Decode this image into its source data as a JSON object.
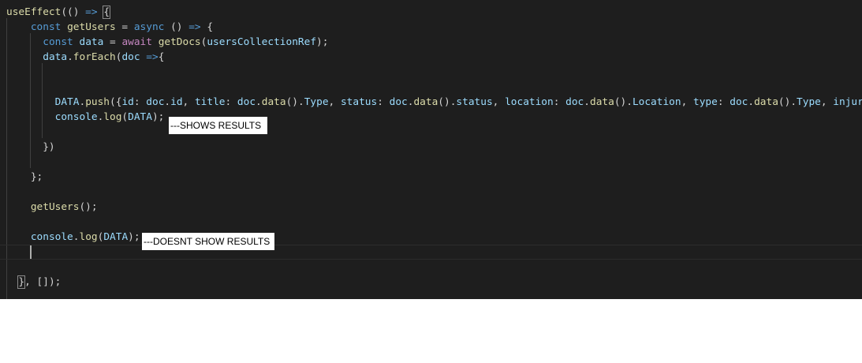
{
  "editor": {
    "background": "#1e1e1e",
    "lines": [
      [
        {
          "t": "useEffect",
          "c": "fn"
        },
        {
          "t": "(() ",
          "c": "pun"
        },
        {
          "t": "=>",
          "c": "kw"
        },
        {
          "t": " ",
          "c": "pun"
        },
        {
          "t": "{",
          "c": "pun",
          "bracket": true
        }
      ],
      [
        {
          "t": "    ",
          "c": "pun"
        },
        {
          "t": "const",
          "c": "kw"
        },
        {
          "t": " ",
          "c": "pun"
        },
        {
          "t": "getUsers",
          "c": "fn"
        },
        {
          "t": " = ",
          "c": "pun"
        },
        {
          "t": "async",
          "c": "kw"
        },
        {
          "t": " () ",
          "c": "pun"
        },
        {
          "t": "=>",
          "c": "kw"
        },
        {
          "t": " {",
          "c": "pun"
        }
      ],
      [
        {
          "t": "      ",
          "c": "pun"
        },
        {
          "t": "const",
          "c": "kw"
        },
        {
          "t": " ",
          "c": "pun"
        },
        {
          "t": "data",
          "c": "var"
        },
        {
          "t": " = ",
          "c": "pun"
        },
        {
          "t": "await",
          "c": "ctl"
        },
        {
          "t": " ",
          "c": "pun"
        },
        {
          "t": "getDocs",
          "c": "fn"
        },
        {
          "t": "(",
          "c": "pun"
        },
        {
          "t": "usersCollectionRef",
          "c": "var"
        },
        {
          "t": ");",
          "c": "pun"
        }
      ],
      [
        {
          "t": "      ",
          "c": "pun"
        },
        {
          "t": "data",
          "c": "var"
        },
        {
          "t": ".",
          "c": "pun"
        },
        {
          "t": "forEach",
          "c": "fn"
        },
        {
          "t": "(",
          "c": "pun"
        },
        {
          "t": "doc",
          "c": "var"
        },
        {
          "t": " ",
          "c": "pun"
        },
        {
          "t": "=>",
          "c": "kw"
        },
        {
          "t": "{",
          "c": "pun"
        }
      ],
      [],
      [],
      [
        {
          "t": "        ",
          "c": "pun"
        },
        {
          "t": "DATA",
          "c": "var"
        },
        {
          "t": ".",
          "c": "pun"
        },
        {
          "t": "push",
          "c": "fn"
        },
        {
          "t": "({",
          "c": "pun"
        },
        {
          "t": "id",
          "c": "var"
        },
        {
          "t": ": ",
          "c": "pun"
        },
        {
          "t": "doc",
          "c": "var"
        },
        {
          "t": ".",
          "c": "pun"
        },
        {
          "t": "id",
          "c": "var"
        },
        {
          "t": ", ",
          "c": "pun"
        },
        {
          "t": "title",
          "c": "var"
        },
        {
          "t": ": ",
          "c": "pun"
        },
        {
          "t": "doc",
          "c": "var"
        },
        {
          "t": ".",
          "c": "pun"
        },
        {
          "t": "data",
          "c": "fn"
        },
        {
          "t": "().",
          "c": "pun"
        },
        {
          "t": "Type",
          "c": "var"
        },
        {
          "t": ", ",
          "c": "pun"
        },
        {
          "t": "status",
          "c": "var"
        },
        {
          "t": ": ",
          "c": "pun"
        },
        {
          "t": "doc",
          "c": "var"
        },
        {
          "t": ".",
          "c": "pun"
        },
        {
          "t": "data",
          "c": "fn"
        },
        {
          "t": "().",
          "c": "pun"
        },
        {
          "t": "status",
          "c": "var"
        },
        {
          "t": ", ",
          "c": "pun"
        },
        {
          "t": "location",
          "c": "var"
        },
        {
          "t": ": ",
          "c": "pun"
        },
        {
          "t": "doc",
          "c": "var"
        },
        {
          "t": ".",
          "c": "pun"
        },
        {
          "t": "data",
          "c": "fn"
        },
        {
          "t": "().",
          "c": "pun"
        },
        {
          "t": "Location",
          "c": "var"
        },
        {
          "t": ", ",
          "c": "pun"
        },
        {
          "t": "type",
          "c": "var"
        },
        {
          "t": ": ",
          "c": "pun"
        },
        {
          "t": "doc",
          "c": "var"
        },
        {
          "t": ".",
          "c": "pun"
        },
        {
          "t": "data",
          "c": "fn"
        },
        {
          "t": "().",
          "c": "pun"
        },
        {
          "t": "Type",
          "c": "var"
        },
        {
          "t": ", ",
          "c": "pun"
        },
        {
          "t": "injur",
          "c": "var"
        }
      ],
      [
        {
          "t": "        ",
          "c": "pun"
        },
        {
          "t": "console",
          "c": "var"
        },
        {
          "t": ".",
          "c": "pun"
        },
        {
          "t": "log",
          "c": "fn"
        },
        {
          "t": "(",
          "c": "pun"
        },
        {
          "t": "DATA",
          "c": "var"
        },
        {
          "t": ");",
          "c": "pun"
        }
      ],
      [],
      [
        {
          "t": "      })",
          "c": "pun"
        }
      ],
      [],
      [
        {
          "t": "    };",
          "c": "pun"
        }
      ],
      [],
      [
        {
          "t": "    ",
          "c": "pun"
        },
        {
          "t": "getUsers",
          "c": "fn"
        },
        {
          "t": "();",
          "c": "pun"
        }
      ],
      [],
      [
        {
          "t": "    ",
          "c": "pun"
        },
        {
          "t": "console",
          "c": "var"
        },
        {
          "t": ".",
          "c": "pun"
        },
        {
          "t": "log",
          "c": "fn"
        },
        {
          "t": "(",
          "c": "pun"
        },
        {
          "t": "DATA",
          "c": "var"
        },
        {
          "t": ");",
          "c": "pun"
        }
      ],
      [],
      [],
      [
        {
          "t": "  ",
          "c": "pun"
        },
        {
          "t": "}",
          "c": "pun",
          "bracket": true
        },
        {
          "t": ", []);",
          "c": "pun"
        }
      ]
    ]
  },
  "annotations": {
    "shows": "---SHOWS RESULTS",
    "doesnt_show": "---DOESNT SHOW RESULTS"
  }
}
